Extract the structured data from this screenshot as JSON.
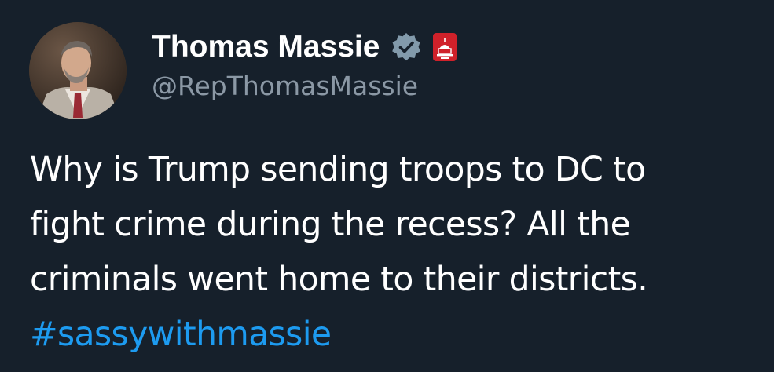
{
  "author": {
    "display_name": "Thomas Massie",
    "handle": "@RepThomasMassie",
    "verified_icon": "verified-badge-icon",
    "affiliation_icon": "us-capitol-badge-icon",
    "colors": {
      "verified": "#829aab",
      "affiliation_badge": "#d0212a",
      "handle_text": "#8b98a5"
    }
  },
  "tweet": {
    "lines": [
      "Why is Trump sending troops to DC to",
      "fight crime during the recess? All the",
      "criminals went home to their districts."
    ],
    "hashtag": "#sassywithmassie",
    "colors": {
      "text": "#ffffff",
      "hashtag": "#1d9bf0",
      "background": "#16202b"
    }
  }
}
